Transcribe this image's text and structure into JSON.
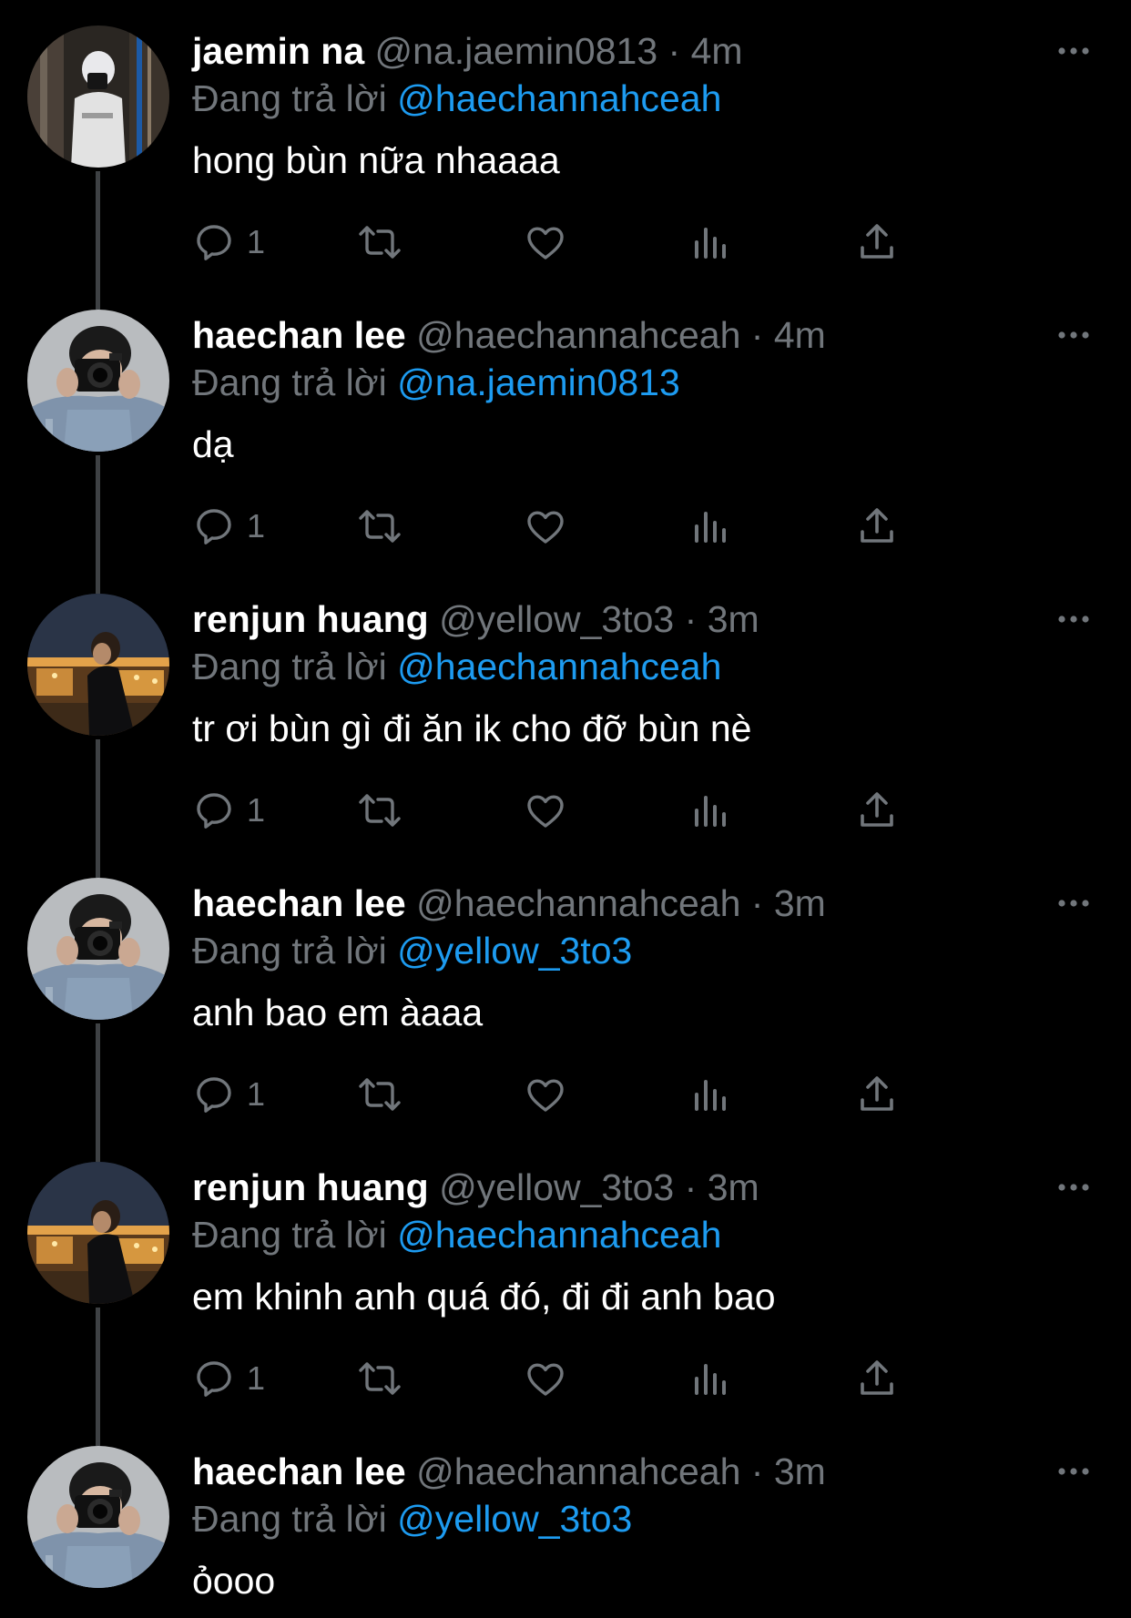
{
  "colors": {
    "background": "#000000",
    "name": "#ffffff",
    "secondary": "#71767b",
    "mention": "#1d9bf0",
    "thread_line": "#3e4144"
  },
  "reply_prefix": "Đang trả lời",
  "tweets": [
    {
      "display_name": "jaemin na",
      "handle": "@na.jaemin0813",
      "time": "4m",
      "reply_to": "@haechannahceah",
      "text": "hong bùn nữa nhaaaa",
      "reply_count": "1",
      "avatar": "jaemin-avatar"
    },
    {
      "display_name": "haechan lee",
      "handle": "@haechannahceah",
      "time": "4m",
      "reply_to": "@na.jaemin0813",
      "text": "dạ",
      "reply_count": "1",
      "avatar": "haechan-avatar"
    },
    {
      "display_name": "renjun huang",
      "handle": "@yellow_3to3",
      "time": "3m",
      "reply_to": "@haechannahceah",
      "text": "tr ơi bùn gì đi ăn ik cho đỡ bùn nè",
      "reply_count": "1",
      "avatar": "renjun-avatar"
    },
    {
      "display_name": "haechan lee",
      "handle": "@haechannahceah",
      "time": "3m",
      "reply_to": "@yellow_3to3",
      "text": "anh bao em àaaa",
      "reply_count": "1",
      "avatar": "haechan-avatar"
    },
    {
      "display_name": "renjun huang",
      "handle": "@yellow_3to3",
      "time": "3m",
      "reply_to": "@haechannahceah",
      "text": "em khinh anh quá đó, đi đi anh bao",
      "reply_count": "1",
      "avatar": "renjun-avatar"
    },
    {
      "display_name": "haechan lee",
      "handle": "@haechannahceah",
      "time": "3m",
      "reply_to": "@yellow_3to3",
      "text": "ỏooo",
      "reply_count": "",
      "avatar": "haechan-avatar"
    }
  ]
}
